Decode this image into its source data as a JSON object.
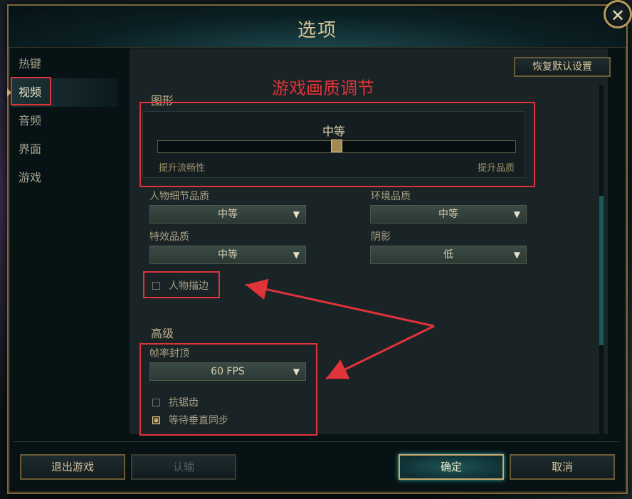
{
  "window": {
    "title": "选项",
    "close_symbol": "✕"
  },
  "sidebar": {
    "items": [
      {
        "label": "热键",
        "active": false
      },
      {
        "label": "视频",
        "active": true
      },
      {
        "label": "音频",
        "active": false
      },
      {
        "label": "界面",
        "active": false
      },
      {
        "label": "游戏",
        "active": false
      }
    ]
  },
  "toolbar": {
    "restore_defaults_label": "恢复默认设置"
  },
  "annotation": {
    "text": "游戏画质调节"
  },
  "graphics": {
    "section_title": "图形",
    "preset_value": "中等",
    "preset_level": 0.5,
    "left_hint": "提升流畅性",
    "right_hint": "提升品质"
  },
  "quality": {
    "character_detail": {
      "label": "人物细节品质",
      "value": "中等"
    },
    "environment": {
      "label": "环境品质",
      "value": "中等"
    },
    "effects": {
      "label": "特效品质",
      "value": "中等"
    },
    "shadows": {
      "label": "阴影",
      "value": "低"
    },
    "dropdown_arrow": "▼"
  },
  "character_outline": {
    "label": "人物描边",
    "checked": false
  },
  "advanced": {
    "section_title": "高级",
    "frame_cap": {
      "label": "帧率封顶",
      "value": "60 FPS"
    },
    "anti_aliasing": {
      "label": "抗锯齿",
      "checked": false
    },
    "vsync": {
      "label": "等待垂直同步",
      "checked": true
    }
  },
  "footer": {
    "exit_game_label": "退出游戏",
    "surrender_label": "认输",
    "ok_label": "确定",
    "cancel_label": "取消"
  },
  "colors": {
    "accent_gold": "#c8aa6e",
    "annotation_red": "#e0333a",
    "primary_teal": "#1e5558"
  }
}
